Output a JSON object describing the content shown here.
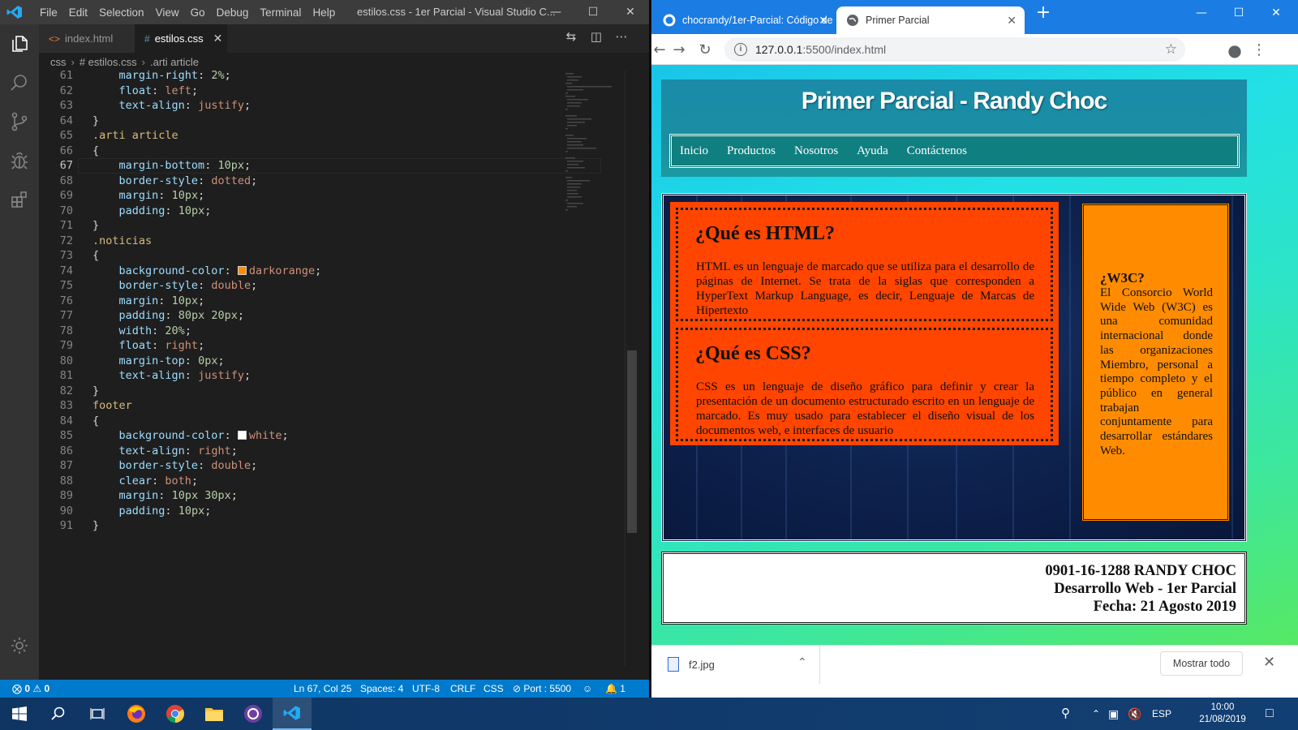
{
  "vscode": {
    "menu": [
      "File",
      "Edit",
      "Selection",
      "View",
      "Go",
      "Debug",
      "Terminal",
      "Help"
    ],
    "window_title": "estilos.css - 1er Parcial - Visual Studio C...",
    "tabs": [
      {
        "label": "index.html",
        "icon": "html-file-icon",
        "active": false
      },
      {
        "label": "estilos.css",
        "icon": "css-file-icon",
        "active": true
      }
    ],
    "breadcrumb": [
      "css",
      "# estilos.css",
      ".arti article"
    ],
    "lines": [
      {
        "n": "61",
        "text": "margin-right: 2%;"
      },
      {
        "n": "62",
        "text": "float: left;"
      },
      {
        "n": "63",
        "text": "text-align: justify;"
      },
      {
        "n": "64",
        "text": "}"
      },
      {
        "n": "65",
        "text": ".arti article"
      },
      {
        "n": "66",
        "text": "{"
      },
      {
        "n": "67",
        "text": "margin-bottom: 10px;"
      },
      {
        "n": "68",
        "text": "border-style: dotted;"
      },
      {
        "n": "69",
        "text": "margin: 10px;"
      },
      {
        "n": "70",
        "text": "padding: 10px;"
      },
      {
        "n": "71",
        "text": "}"
      },
      {
        "n": "72",
        "text": ".noticias"
      },
      {
        "n": "73",
        "text": "{"
      },
      {
        "n": "74",
        "text": "background-color: darkorange;"
      },
      {
        "n": "75",
        "text": "border-style: double;"
      },
      {
        "n": "76",
        "text": "margin: 10px;"
      },
      {
        "n": "77",
        "text": "padding: 80px 20px;"
      },
      {
        "n": "78",
        "text": "width: 20%;"
      },
      {
        "n": "79",
        "text": "float: right;"
      },
      {
        "n": "80",
        "text": "margin-top: 0px;"
      },
      {
        "n": "81",
        "text": "text-align: justify;"
      },
      {
        "n": "82",
        "text": "}"
      },
      {
        "n": "83",
        "text": "footer"
      },
      {
        "n": "84",
        "text": "{"
      },
      {
        "n": "85",
        "text": "background-color: white;"
      },
      {
        "n": "86",
        "text": "text-align: right;"
      },
      {
        "n": "87",
        "text": "border-style: double;"
      },
      {
        "n": "88",
        "text": "clear: both;"
      },
      {
        "n": "89",
        "text": "margin: 10px 30px;"
      },
      {
        "n": "90",
        "text": "padding: 10px;"
      },
      {
        "n": "91",
        "text": "}"
      }
    ],
    "current_line": "67",
    "status": {
      "errors": "0",
      "warnings": "0",
      "position": "Ln 67, Col 25",
      "spaces": "Spaces: 4",
      "encoding": "UTF-8",
      "eol": "CRLF",
      "language": "CSS",
      "port": "Port : 5500",
      "notifications": "1"
    },
    "colors": {
      "accent": "#007acc",
      "editor_bg": "#1e1e1e",
      "darkorange": "#ff8c00",
      "white": "#ffffff"
    }
  },
  "chrome": {
    "tabs": [
      {
        "label": "chocrandy/1er-Parcial: Código de",
        "icon": "github-icon",
        "active": false
      },
      {
        "label": "Primer Parcial",
        "icon": "globe-icon",
        "active": true
      }
    ],
    "url_host": "127.0.0.1",
    "url_rest": ":5500/index.html",
    "page": {
      "title": "Primer Parcial - Randy Choc",
      "nav": [
        "Inicio",
        "Productos",
        "Nosotros",
        "Ayuda",
        "Contáctenos"
      ],
      "articles": [
        {
          "heading": "¿Qué es HTML?",
          "body": "HTML es un lenguaje de marcado que se utiliza para el desarrollo de páginas de Internet. Se trata de la siglas que corresponden a HyperText Markup Language, es decir, Lenguaje de Marcas de Hipertexto"
        },
        {
          "heading": "¿Qué es CSS?",
          "body": "CSS es un lenguaje de diseño gráfico para definir y crear la presentación de un documento estructurado escrito en un lenguaje de marcado. Es muy usado para establecer el diseño visual de los documentos web, e interfaces de usuario"
        }
      ],
      "aside": {
        "heading": "¿W3C?",
        "body": "El Consorcio World Wide Web (W3C) es una comunidad internacional donde las organizaciones Miembro, personal a tiempo completo y el público en general trabajan conjuntamente para desarrollar estándares Web."
      },
      "footer": [
        "0901-16-1288 RANDY CHOC",
        "Desarrollo Web - 1er Parcial",
        "Fecha: 21 Agosto 2019"
      ],
      "colors": {
        "article": "#ff4500",
        "aside": "#ff8c00",
        "nav": "#107f80"
      }
    },
    "download": {
      "filename": "f2.jpg",
      "show_all": "Mostrar todo"
    }
  },
  "taskbar": {
    "apps": [
      "start-icon",
      "search-icon",
      "task-view-icon",
      "firefox-icon",
      "chrome-icon",
      "file-explorer-icon",
      "app-icon",
      "vscode-icon"
    ],
    "lang": "ESP",
    "time": "10:00",
    "date": "21/08/2019"
  }
}
